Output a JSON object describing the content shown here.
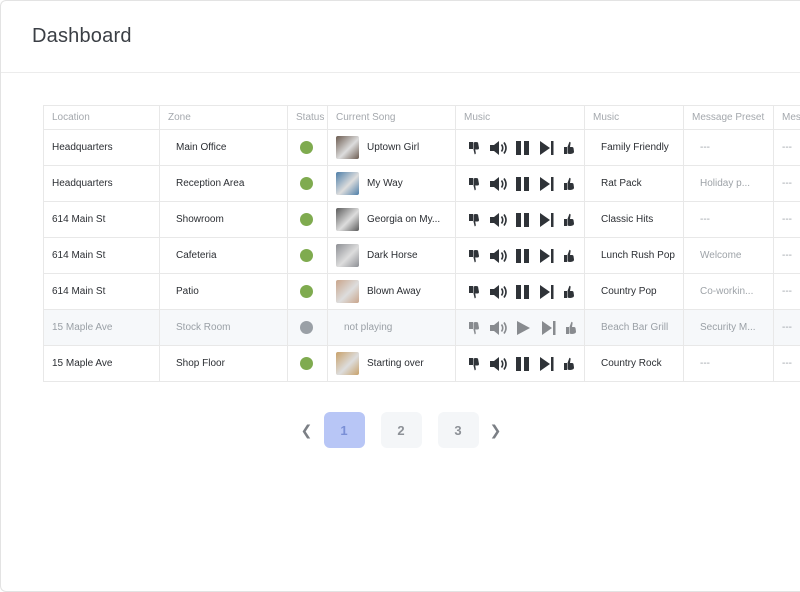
{
  "header": {
    "title": "Dashboard"
  },
  "colors": {
    "active_status": "#7fab4f",
    "inactive_status": "#9aa0a6",
    "active_page": "#b8c6f6"
  },
  "table": {
    "columns": [
      "Location",
      "Zone",
      "Status",
      "Current Song",
      "Music",
      "Music",
      "Message Preset",
      "Mess"
    ],
    "rows": [
      {
        "location": "Headquarters",
        "zone": "Main Office",
        "status": "active",
        "song": "Uptown Girl",
        "play_state": "pause",
        "music": "Family Friendly",
        "preset": "---",
        "message": "---"
      },
      {
        "location": "Headquarters",
        "zone": "Reception Area",
        "status": "active",
        "song": "My Way",
        "play_state": "pause",
        "music": "Rat Pack",
        "preset": "Holiday p...",
        "message": "---"
      },
      {
        "location": "614 Main St",
        "zone": "Showroom",
        "status": "active",
        "song": "Georgia on My...",
        "play_state": "pause",
        "music": "Classic Hits",
        "preset": "---",
        "message": "---"
      },
      {
        "location": "614 Main St",
        "zone": "Cafeteria",
        "status": "active",
        "song": "Dark Horse",
        "play_state": "pause",
        "music": "Lunch Rush Pop",
        "preset": "Welcome",
        "message": "---"
      },
      {
        "location": "614 Main St",
        "zone": "Patio",
        "status": "active",
        "song": "Blown Away",
        "play_state": "pause",
        "music": "Country Pop",
        "preset": "Co-workin...",
        "message": "---"
      },
      {
        "location": "15 Maple Ave",
        "zone": "Stock Room",
        "status": "inactive",
        "song": "not playing",
        "play_state": "play",
        "music": "Beach Bar Grill",
        "preset": "Security M...",
        "message": "---"
      },
      {
        "location": "15 Maple Ave",
        "zone": "Shop Floor",
        "status": "active",
        "song": "Starting over",
        "play_state": "pause",
        "music": "Country Rock",
        "preset": "---",
        "message": "---"
      }
    ]
  },
  "pagination": {
    "pages": [
      "1",
      "2",
      "3"
    ],
    "current": "1",
    "prev_icon": "chevron-left-icon",
    "next_icon": "chevron-right-icon"
  }
}
